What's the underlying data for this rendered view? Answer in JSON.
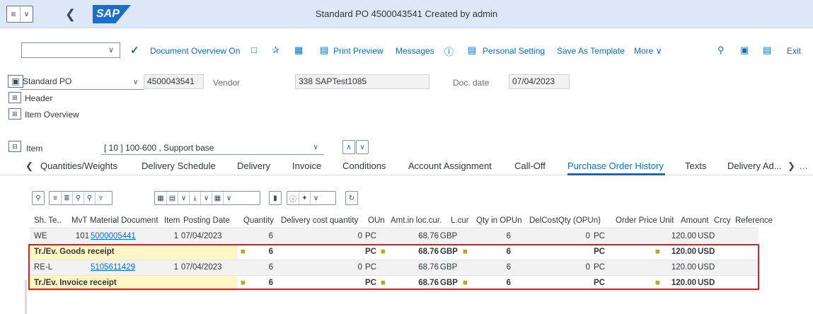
{
  "titlebar": {
    "title": "Standard PO 4500043541 Created by admin",
    "back_icon": "chevron-left-icon",
    "menu_icon": "menu-list-icon",
    "logo_text": "SAP"
  },
  "toolbar": {
    "command_value": "",
    "document_overview": "Document Overview On",
    "print_preview": "Print Preview",
    "messages": "Messages",
    "personal_setting": "Personal Setting",
    "save_as_template": "Save As Template",
    "more": "More",
    "exit": "Exit"
  },
  "header": {
    "doc_type": "Standard PO",
    "po_number": "4500043541",
    "vendor_label": "Vendor",
    "vendor_value": "338 SAPTest1085",
    "doc_date_label": "Doc. date",
    "doc_date_value": "07/04/2023",
    "header_label": "Header",
    "item_overview_label": "Item Overview",
    "item_label": "Item",
    "item_value": "[ 10 ] 100-600 , Support base"
  },
  "tabs": [
    "Quantities/Weights",
    "Delivery Schedule",
    "Delivery",
    "Invoice",
    "Conditions",
    "Account Assignment",
    "Call-Off",
    "Purchase Order History",
    "Texts",
    "Delivery Ad..."
  ],
  "active_tab": "Purchase Order History",
  "grid": {
    "columns": [
      "Sh. Te..",
      "MvT",
      "Material Document",
      "Item",
      "Posting Date",
      "Quantity",
      "Delivery cost quantity",
      "OUn",
      "Amt.in loc.cur.",
      "L.cur",
      "Qty in OPUn",
      "DelCostQty (OPUn)",
      "Order Price Unit",
      "Amount",
      "Crcy",
      "Reference"
    ],
    "rows": [
      {
        "type": "data",
        "sh": "WE",
        "mvt": "101",
        "matdoc": "5000005441",
        "item": "1",
        "date": "07/04/2023",
        "qty": "6",
        "delcost": "0",
        "oun": "PC",
        "amt": "68.76",
        "lcur": "GBP",
        "qtyop": "6",
        "delcostop": "0",
        "opu": "PC",
        "amount": "120.00",
        "crcy": "USD"
      },
      {
        "type": "sum",
        "label": "Tr./Ev. Goods receipt",
        "qty": "6",
        "oun": "PC",
        "amt": "68.76",
        "lcur": "GBP",
        "qtyop": "6",
        "opu": "PC",
        "amount": "120.00",
        "crcy": "USD"
      },
      {
        "type": "data",
        "sh": "RE-L",
        "mvt": "",
        "matdoc": "5105611429",
        "item": "1",
        "date": "07/04/2023",
        "qty": "6",
        "delcost": "0",
        "oun": "PC",
        "amt": "68.76",
        "lcur": "GBP",
        "qtyop": "6",
        "delcostop": "0",
        "opu": "PC",
        "amount": "120.00",
        "crcy": "USD"
      },
      {
        "type": "sum",
        "label": "Tr./Ev. Invoice receipt",
        "qty": "6",
        "oun": "PC",
        "amt": "68.76",
        "lcur": "GBP",
        "qtyop": "6",
        "opu": "PC",
        "amount": "120.00",
        "crcy": "USD"
      }
    ]
  }
}
